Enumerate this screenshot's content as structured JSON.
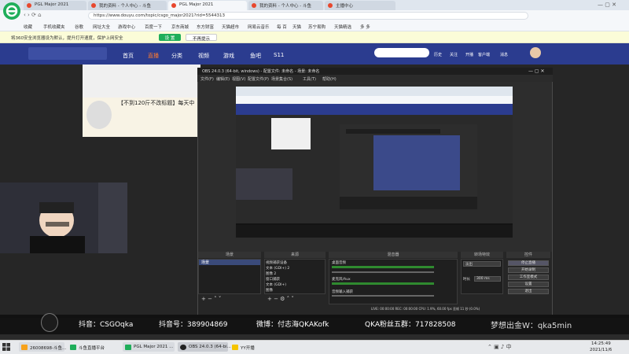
{
  "browser": {
    "tabs": [
      {
        "label": "PGL Major 2021"
      },
      {
        "label": "我的资料 - 个人中心 - 斗鱼"
      },
      {
        "label": "PGL Major 2021"
      },
      {
        "label": "我的资料 - 个人中心 - 斗鱼"
      },
      {
        "label": "主播中心"
      }
    ],
    "url": "https://www.douyu.com/topic/csgo_major2021?rid=5544313",
    "bookmarks": [
      "收藏",
      "手机收藏夹",
      "谷歌",
      "网址大全",
      "游戏中心",
      "百度一下",
      "京东商城",
      "东方财富",
      "天猫超市",
      "网易云音乐",
      "每 百",
      "天猫",
      "苏宁易购",
      "天猫精选",
      "多 多"
    ],
    "notice": "将360安全浏览器设为默认，提升打开速度，保护上网安全",
    "notice_btn_yes": "设 置",
    "notice_btn_no": "不再提示"
  },
  "site": {
    "nav": [
      "首页",
      "直播",
      "分类",
      "视频",
      "游戏",
      "鱼吧",
      "S11"
    ],
    "search_placeholder": "",
    "right_items": [
      "历史",
      "关注",
      "开播",
      "客户端",
      "消息"
    ],
    "title_banner": "【不到120斤不改标题】每天中"
  },
  "obs": {
    "title": "OBS 24.0.3 (64-bit, windows) - 配置文件: 未命名 - 场景: 未命名",
    "menu": [
      "文件(F)",
      "编辑(E)",
      "视图(V)",
      "配置文件(P)",
      "场景集合(S)",
      "工具(T)",
      "帮助(H)"
    ],
    "docks": {
      "scenes": "场景",
      "sources": "来源",
      "mixer": "混音器",
      "transitions": "转场特效",
      "controls": "控件"
    },
    "scene_item": "场景",
    "sources": [
      "视频捕获设备",
      "文本 (GDI+) 2",
      "图像 2",
      "窗口捕获",
      "文本 (GDI+)",
      "图像"
    ],
    "mixer_tracks": [
      "桌面音频",
      "麦克风/Aux",
      "音频输入捕获"
    ],
    "transition_value": "淡出",
    "duration_label": "时长",
    "duration_value": "300 ms",
    "controls": [
      "停止直播",
      "开始录制",
      "工作室模式",
      "设置",
      "退出"
    ],
    "status": "LIVE: 00:00:00   REC: 00:00:00   CPU: 1.9%, 60.00 fps   丢帧 11 秒 (0.0%)"
  },
  "overlay": {
    "tiktok1": "抖音：CSGOqka",
    "tiktok2": "抖音号：389904869",
    "weibo": "微博：付志海QKAKofk",
    "fans": "QKA粉丝五群：717828508",
    "wechat": "梦想出金W：qka5min"
  },
  "taskbar": {
    "items": [
      "26008698-斗鱼...",
      "斗鱼直播平台",
      "PGL Major 2021 ...",
      "OBS 24.0.3 (64-bi...",
      "YY开播"
    ],
    "time": "14:25:49",
    "date": "2021/11/6"
  },
  "colors": {
    "accent_nav": "#2b3c8f",
    "brand_green": "#1fae5a"
  }
}
